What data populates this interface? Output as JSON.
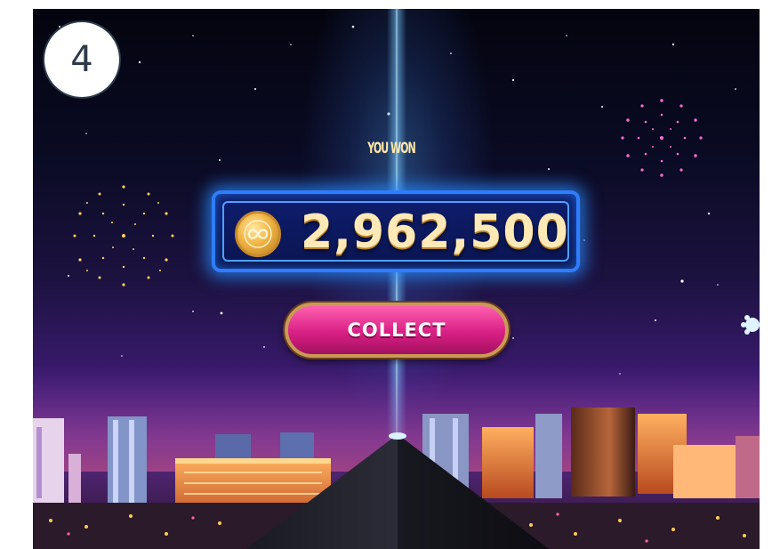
{
  "step_badge": {
    "label": "4"
  },
  "reward": {
    "heading": "YOU WON",
    "amount": "2,962,500",
    "currency_icon": "infinity-coin-icon"
  },
  "collect_button": {
    "label": "COLLECT"
  },
  "colors": {
    "panel_border": "#2f7dff",
    "amount_text": "#ffe9b6",
    "button_pink": "#d91f85",
    "button_border": "#c89a55",
    "beam": "#78c8ff"
  }
}
